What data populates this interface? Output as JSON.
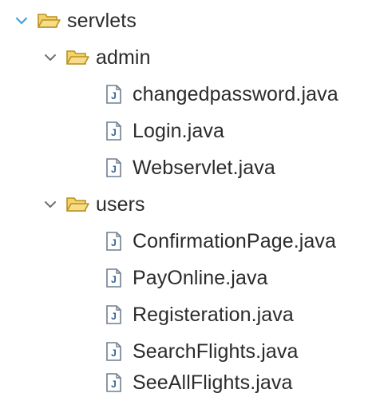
{
  "tree": {
    "root": {
      "label": "servlets",
      "icon": "folder-open-icon",
      "expanded": true
    },
    "folders": [
      {
        "label": "admin",
        "icon": "folder-open-icon",
        "expanded": true,
        "files": [
          {
            "label": "changedpassword.java",
            "icon": "java-file-icon"
          },
          {
            "label": "Login.java",
            "icon": "java-file-icon"
          },
          {
            "label": "Webservlet.java",
            "icon": "java-file-icon"
          }
        ]
      },
      {
        "label": "users",
        "icon": "folder-open-icon",
        "expanded": true,
        "files": [
          {
            "label": "ConfirmationPage.java",
            "icon": "java-file-icon"
          },
          {
            "label": "PayOnline.java",
            "icon": "java-file-icon"
          },
          {
            "label": "Registeration.java",
            "icon": "java-file-icon"
          },
          {
            "label": "SearchFlights.java",
            "icon": "java-file-icon"
          },
          {
            "label": "SeeAllFlights.java",
            "icon": "java-file-icon"
          }
        ]
      }
    ]
  },
  "colors": {
    "chevron_root": "#4a9fd8",
    "chevron_child": "#707070",
    "folder_fill": "#f4d36b",
    "folder_stroke": "#b89222",
    "file_fill": "#ffffff",
    "file_stroke": "#6f7f90",
    "file_letter": "#2f5d90"
  }
}
